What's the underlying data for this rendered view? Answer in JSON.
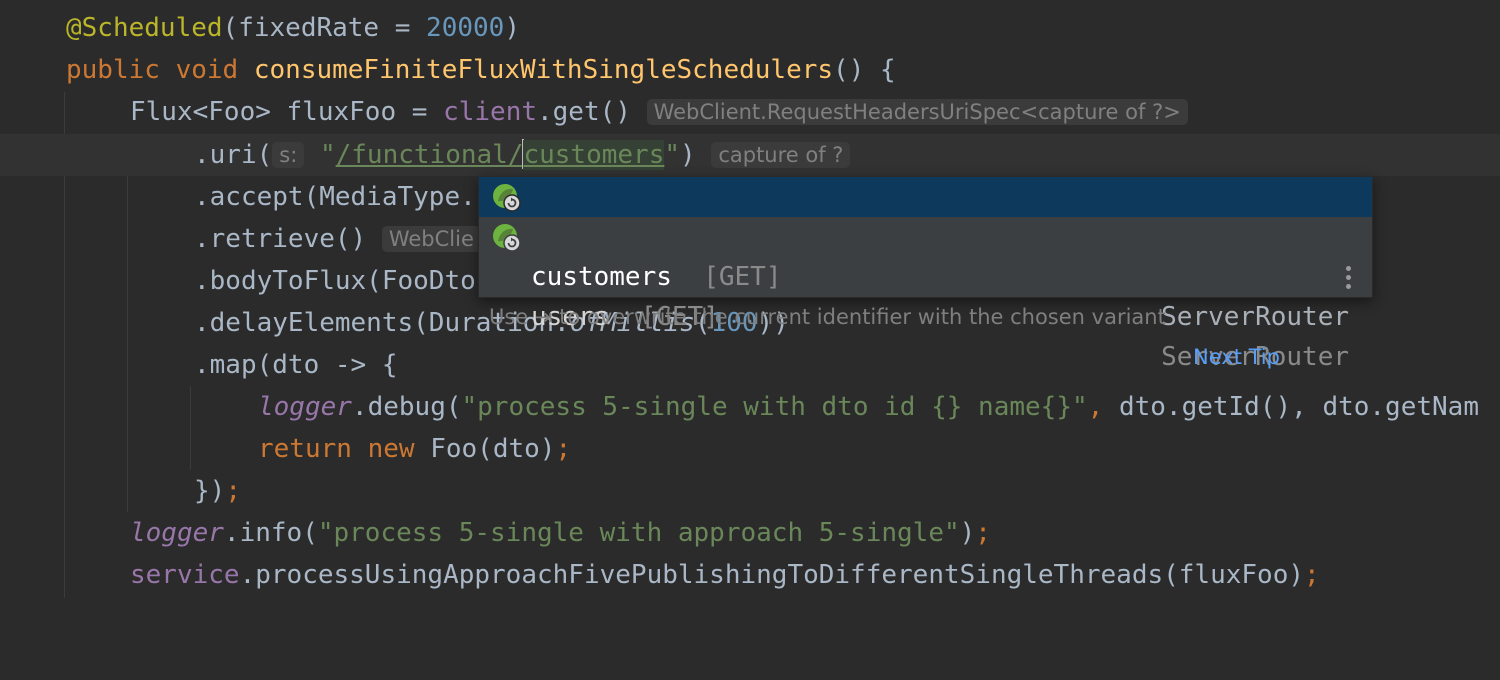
{
  "code": {
    "line1": {
      "annotation": "@Scheduled",
      "open": "(fixedRate = ",
      "value": "20000",
      "close": ")"
    },
    "line2": {
      "kw1": "public",
      "kw2": "void",
      "method": "consumeFiniteFluxWithSingleSchedulers",
      "rest": "() {"
    },
    "line3": {
      "type": "Flux<Foo> fluxFoo = ",
      "field": "client",
      "call": ".get()",
      "hint": "WebClient.RequestHeadersUriSpec<capture of ?>"
    },
    "line4": {
      "call": ".uri(",
      "param_hint": "s:",
      "quote_open": "\"",
      "path_before": "/functional/",
      "path_after": "customers",
      "quote_close": "\"",
      "paren": ")",
      "hint": "capture of ?"
    },
    "line5": {
      "text": ".accept(MediaType."
    },
    "line6": {
      "text": ".retrieve()",
      "hint": "WebClie"
    },
    "line7": {
      "text": ".bodyToFlux(FooDto"
    },
    "line8": {
      "call": ".delayElements(Duration.",
      "method": "ofMillis",
      "open": "(",
      "value": "100",
      "close": "))"
    },
    "line9": {
      "text": ".map(dto -> {"
    },
    "line10": {
      "field": "logger",
      "call": ".debug(",
      "str": "\"process 5-single with dto id {} name{}\"",
      "sep": ", ",
      "rest": "dto.getId(), dto.getNam"
    },
    "line11": {
      "kw1": "return",
      "kw2": "new",
      "rest": "Foo(dto)",
      "semi": ";"
    },
    "line12": {
      "brace": "})",
      "semi": ";"
    },
    "line13": {
      "field": "logger",
      "call": ".info(",
      "str": "\"process 5-single with approach 5-single\"",
      "close": ")",
      "semi": ";"
    },
    "line14": {
      "field": "service",
      "rest": ".processUsingApproachFivePublishingToDifferentSingleThreads(fluxFoo)",
      "semi": ";"
    }
  },
  "completion": {
    "items": [
      {
        "name": "customers",
        "tail": "[GET]",
        "type": "ServerRouter",
        "icon": "spring-endpoint-icon",
        "selected": true
      },
      {
        "name": "users",
        "tail": "[GET]",
        "type": "ServerRouter",
        "icon": "spring-endpoint-icon",
        "selected": false
      }
    ],
    "tip": "Use ⇥ to overwrite the current identifier with the chosen variant",
    "next_tip": "Next Tip",
    "more_icon": "vertical-ellipsis-icon"
  },
  "colors": {
    "background": "#2b2b2b",
    "keyword": "#cc7832",
    "string": "#6a8759",
    "number": "#6897bb",
    "method": "#ffc66d",
    "field": "#9876aa",
    "selection": "#0d3a5c",
    "link": "#589df6"
  }
}
